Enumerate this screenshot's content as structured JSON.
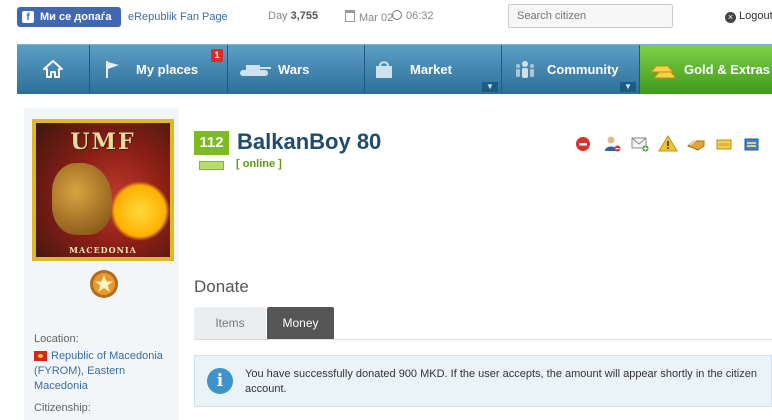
{
  "topbar": {
    "fb_like_label": "Ми се допаѓа",
    "fan_page_link": "eRepublik Fan Page",
    "day_label": "Day",
    "day_value": "3,755",
    "date": "Mar 02",
    "time": "06:32",
    "search_placeholder": "Search citizen",
    "logout_label": "Logout"
  },
  "nav": {
    "home_icon": "home-icon",
    "items": [
      {
        "label": "My places",
        "icon": "flag-icon",
        "badge": "1"
      },
      {
        "label": "Wars",
        "icon": "tank-icon"
      },
      {
        "label": "Market",
        "icon": "shopping-bag-icon"
      },
      {
        "label": "Community",
        "icon": "people-icon"
      },
      {
        "label": "Gold & Extras",
        "icon": "gold-bars-icon"
      }
    ],
    "colors": {
      "nav": "#2c6f99",
      "gold": "#3f9a1a",
      "badge": "#e02a2a"
    }
  },
  "profile": {
    "avatar_title": "UMF",
    "avatar_caption": "MACEDONIA",
    "level": "112",
    "name": "BalkanBoy 80",
    "status": "[ online ]",
    "actions": [
      "block-icon",
      "add-friend-icon",
      "send-message-icon",
      "report-icon",
      "donate-items-icon",
      "donate-money-icon",
      "exchange-icon"
    ]
  },
  "sidebar": {
    "location_label": "Location:",
    "location_value": "Republic of Macedonia (FYROM), Eastern Macedonia",
    "citizenship_label": "Citizenship:"
  },
  "donate": {
    "title": "Donate",
    "tabs": [
      {
        "label": "Items",
        "active": false
      },
      {
        "label": "Money",
        "active": true
      }
    ],
    "message": "You have successfully donated 900 MKD. If the user accepts, the amount will appear shortly in the citizen account."
  }
}
